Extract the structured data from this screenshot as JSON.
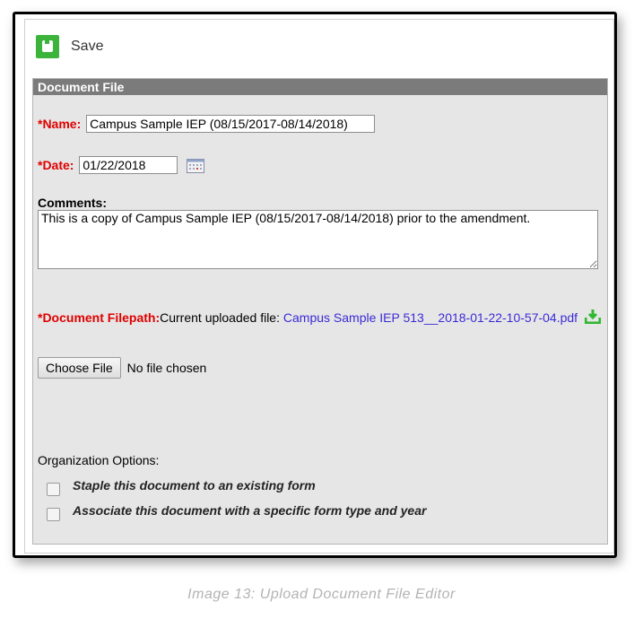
{
  "toolbar": {
    "save_label": "Save"
  },
  "section": {
    "title": "Document File"
  },
  "form": {
    "name_label": "*Name:",
    "name_value": "Campus Sample IEP (08/15/2017-08/14/2018)",
    "date_label": "*Date:",
    "date_value": "01/22/2018",
    "comments_label": "Comments:",
    "comments_value": "This is a copy of Campus Sample IEP (08/15/2017-08/14/2018) prior to the amendment.",
    "filepath_label": "*Document Filepath:",
    "current_file_prefix": "Current uploaded file: ",
    "current_file_link": "Campus Sample IEP 513__2018-01-22-10-57-04.pdf",
    "choose_file_label": "Choose File",
    "no_file_text": "No file chosen"
  },
  "organization": {
    "title": "Organization Options:",
    "options": [
      {
        "label": "Staple this document to an existing form",
        "checked": false
      },
      {
        "label": "Associate this document with a specific form type and year",
        "checked": false
      }
    ]
  },
  "caption": "Image 13: Upload Document File Editor",
  "colors": {
    "required": "#e00000",
    "link": "#3a2bd6",
    "save_green": "#3cb43c",
    "header_gray": "#7b7b7b"
  },
  "icons": [
    "save-disk-icon",
    "calendar-icon",
    "download-icon"
  ]
}
